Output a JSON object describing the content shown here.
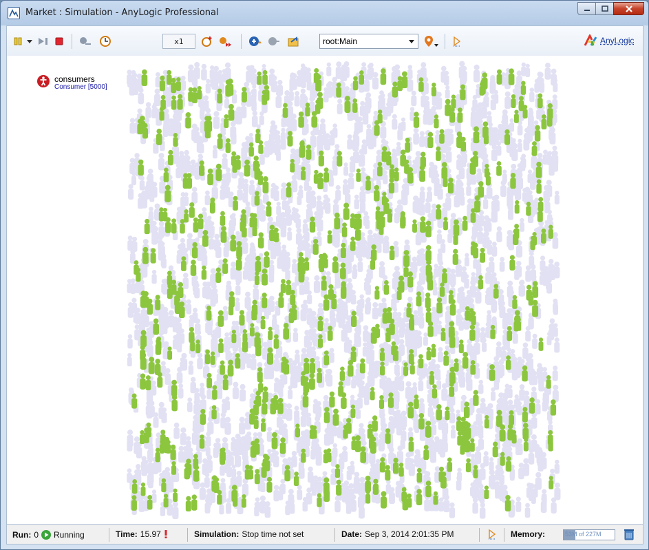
{
  "window": {
    "title": "Market : Simulation - AnyLogic Professional",
    "app_icon": "anylogic-app-icon",
    "controls": {
      "minimize": "minimize-icon",
      "maximize": "maximize-icon",
      "close": "close-icon"
    }
  },
  "toolbar": {
    "run_controls": [
      "pause-icon",
      "dropdown-arrow-icon",
      "step-icon",
      "stop-icon"
    ],
    "time_controls": [
      "slow-down-icon",
      "real-time-mode-icon",
      "speed-up-icon",
      "virtual-time-icon"
    ],
    "speed": "x1",
    "nav_controls": [
      "navigate-up-icon",
      "navigate-back-icon",
      "open-agent-icon"
    ],
    "agent_combo": {
      "value": "root:Main"
    },
    "extra_controls": [
      "location-marker-icon",
      "play-outline-icon"
    ],
    "brand": "AnyLogic"
  },
  "canvas": {
    "legend": {
      "icon": "agent-person-icon",
      "name": "consumers",
      "type": "Consumer [5000]"
    },
    "agent_colors": {
      "potential_user": "#e2e1f3",
      "adopter": "#8cc63e"
    }
  },
  "status": {
    "run_label": "Run:",
    "run_value": "0",
    "state": "Running",
    "time_label": "Time:",
    "time_value": "15.97",
    "simulation_label": "Simulation:",
    "simulation_value": "Stop time not set",
    "date_label": "Date:",
    "date_value": "Sep 3, 2014 2:01:35 PM",
    "memory_label": "Memory:",
    "memory_value": "53M of 227M",
    "memory_fraction": 0.23
  }
}
